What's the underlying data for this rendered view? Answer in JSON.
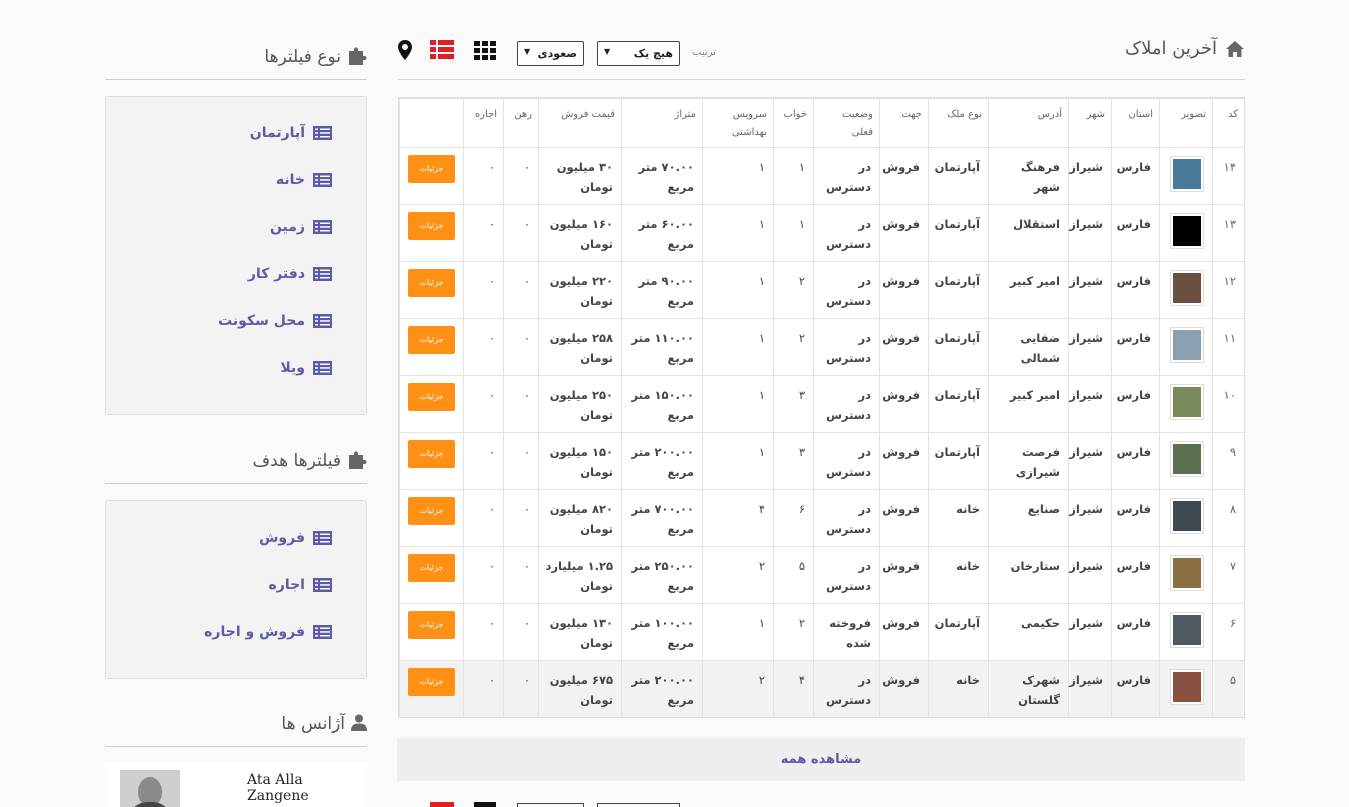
{
  "header": {
    "title": "آخرین املاک",
    "sort_label": "ترتیب",
    "sort_field": "هیچ یک",
    "sort_order": "صعودی"
  },
  "table": {
    "columns": [
      "کد",
      "تصویر",
      "استان",
      "شهر",
      "آدرس",
      "نوع ملک",
      "جهت",
      "وضعیت فعلی",
      "خواب",
      "سرویس بهداشتی",
      "متراژ",
      "قیمت فروش",
      "رهن",
      "اجاره",
      ""
    ],
    "details_label": "جزئیات",
    "rows": [
      {
        "code": "۱۴",
        "province": "فارس",
        "city": "شیراز",
        "address": "فرهنگ شهر",
        "type": "آپارتمان",
        "dir": "فروش",
        "status": "در دسترس",
        "bed": "۱",
        "bath": "۱",
        "area": "۷۰.۰۰ متر مربع",
        "price": "۳۰ میلیون تومان",
        "rahn": "۰",
        "ejare": "۰",
        "img": "#4a7a9a"
      },
      {
        "code": "۱۳",
        "province": "فارس",
        "city": "شیراز",
        "address": "استقلال",
        "type": "آپارتمان",
        "dir": "فروش",
        "status": "در دسترس",
        "bed": "۱",
        "bath": "۱",
        "area": "۶۰.۰۰ متر مربع",
        "price": "۱۶۰ میلیون تومان",
        "rahn": "۰",
        "ejare": "۰",
        "img": "#000000"
      },
      {
        "code": "۱۲",
        "province": "فارس",
        "city": "شیراز",
        "address": "امیر کبیر",
        "type": "آپارتمان",
        "dir": "فروش",
        "status": "در دسترس",
        "bed": "۲",
        "bath": "۱",
        "area": "۹۰.۰۰ متر مربع",
        "price": "۲۲۰ میلیون تومان",
        "rahn": "۰",
        "ejare": "۰",
        "img": "#6a5040"
      },
      {
        "code": "۱۱",
        "province": "فارس",
        "city": "شیراز",
        "address": "ضفایی شمالی",
        "type": "آپارتمان",
        "dir": "فروش",
        "status": "در دسترس",
        "bed": "۲",
        "bath": "۱",
        "area": "۱۱۰.۰۰ متر مربع",
        "price": "۲۵۸ میلیون تومان",
        "rahn": "۰",
        "ejare": "۰",
        "img": "#8aa0b0"
      },
      {
        "code": "۱۰",
        "province": "فارس",
        "city": "شیراز",
        "address": "امیر کبیر",
        "type": "آپارتمان",
        "dir": "فروش",
        "status": "در دسترس",
        "bed": "۳",
        "bath": "۱",
        "area": "۱۵۰.۰۰ متر مربع",
        "price": "۲۵۰ میلیون تومان",
        "rahn": "۰",
        "ejare": "۰",
        "img": "#7a8a5a"
      },
      {
        "code": "۹",
        "province": "فارس",
        "city": "شیراز",
        "address": "فرصت شیرازی",
        "type": "آپارتمان",
        "dir": "فروش",
        "status": "در دسترس",
        "bed": "۳",
        "bath": "۱",
        "area": "۲۰۰.۰۰ متر مربع",
        "price": "۱۵۰ میلیون تومان",
        "rahn": "۰",
        "ejare": "۰",
        "img": "#5a7050"
      },
      {
        "code": "۸",
        "province": "فارس",
        "city": "شیراز",
        "address": "صنایع",
        "type": "خانه",
        "dir": "فروش",
        "status": "در دسترس",
        "bed": "۶",
        "bath": "۴",
        "area": "۷۰۰.۰۰ متر مربع",
        "price": "۸۲۰ میلیون تومان",
        "rahn": "۰",
        "ejare": "۰",
        "img": "#404850"
      },
      {
        "code": "۷",
        "province": "فارس",
        "city": "شیراز",
        "address": "ستارخان",
        "type": "خانه",
        "dir": "فروش",
        "status": "در دسترس",
        "bed": "۵",
        "bath": "۲",
        "area": "۲۵۰.۰۰ متر مربع",
        "price": "۱.۲۵ میلیارد تومان",
        "rahn": "۰",
        "ejare": "۰",
        "img": "#8a7040"
      },
      {
        "code": "۶",
        "province": "فارس",
        "city": "شیراز",
        "address": "حکیمی",
        "type": "آپارتمان",
        "dir": "فروش",
        "status": "فروخته شده",
        "bed": "۲",
        "bath": "۱",
        "area": "۱۰۰.۰۰ متر مربع",
        "price": "۱۳۰ میلیون تومان",
        "rahn": "۰",
        "ejare": "۰",
        "img": "#505860"
      },
      {
        "code": "۵",
        "province": "فارس",
        "city": "شیراز",
        "address": "شهرک گلستان",
        "type": "خانه",
        "dir": "فروش",
        "status": "در دسترس",
        "bed": "۴",
        "bath": "۲",
        "area": "۲۰۰.۰۰ متر مربع",
        "price": "۶۷۵ میلیون تومان",
        "rahn": "۰",
        "ejare": "۰",
        "img": "#8a5040"
      }
    ]
  },
  "view_all": "مشاهده همه",
  "sidebar": {
    "type_title": "نوع فیلترها",
    "type_items": [
      "آپارتمان",
      "خانه",
      "زمین",
      "دفتر کار",
      "محل سکونت",
      "ویلا"
    ],
    "goal_title": "فیلترها هدف",
    "goal_items": [
      "فروش",
      "اجاره",
      "فروش و اجاره"
    ],
    "agents_title": "آژانس ها",
    "agent_name": "Ata Alla Zangene"
  },
  "colors": {
    "accent": "#5b5ba8",
    "button": "#ff9016",
    "red": "#e02020"
  }
}
